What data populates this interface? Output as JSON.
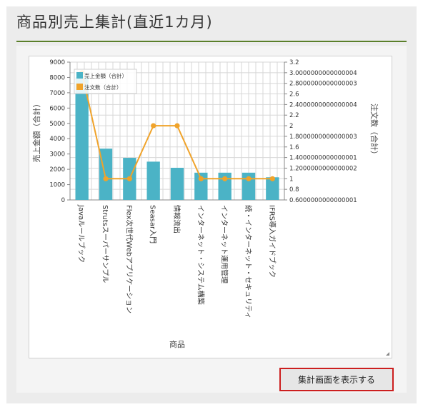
{
  "page_title": "商品別売上集計(直近1カ月)",
  "button_label": "集計画面を表示する",
  "colors": {
    "bar": "#4bb3c6",
    "line": "#f0a32a",
    "rule": "#5a7f2a",
    "button_border": "#cc1f1f"
  },
  "chart_data": {
    "type": "bar",
    "xlabel": "商品",
    "ylabel": "売上金額（合計）",
    "y2label": "注文数（合計）",
    "categories": [
      "Javaルールブック",
      "Strutsスーパーサンプル",
      "Flex次世代Webアプリケーション",
      "Seasar入門",
      "情報流出",
      "インターネット・システム構築",
      "インターネット運用管理",
      "続・インターネット・セキュリティ",
      "IFRS導入ガイドブック"
    ],
    "series": [
      {
        "name": "売上金額（合計）",
        "type": "bar",
        "axis": "left",
        "values": [
          8000,
          3350,
          2750,
          2500,
          2100,
          1780,
          1780,
          1780,
          1480
        ]
      },
      {
        "name": "注文数（合計）",
        "type": "line",
        "axis": "right",
        "values": [
          3,
          1,
          1,
          2,
          2,
          1,
          1,
          1,
          1
        ]
      }
    ],
    "ylim": [
      0,
      9000
    ],
    "yticks": [
      "0",
      "1000",
      "2000",
      "3000",
      "4000",
      "5000",
      "6000",
      "7000",
      "8000",
      "9000"
    ],
    "y2lim": [
      0.6,
      3.2
    ],
    "y2ticks": [
      "0.6000000000000001",
      "0.8",
      "1",
      "1.2000000000000002",
      "1.4000000000000001",
      "1.6",
      "1.8000000000000003",
      "2",
      "2.2",
      "2.4000000000000004",
      "2.6",
      "2.8000000000000003",
      "3.0000000000000004",
      "3.2"
    ],
    "legend": "top-left",
    "grid": true
  }
}
